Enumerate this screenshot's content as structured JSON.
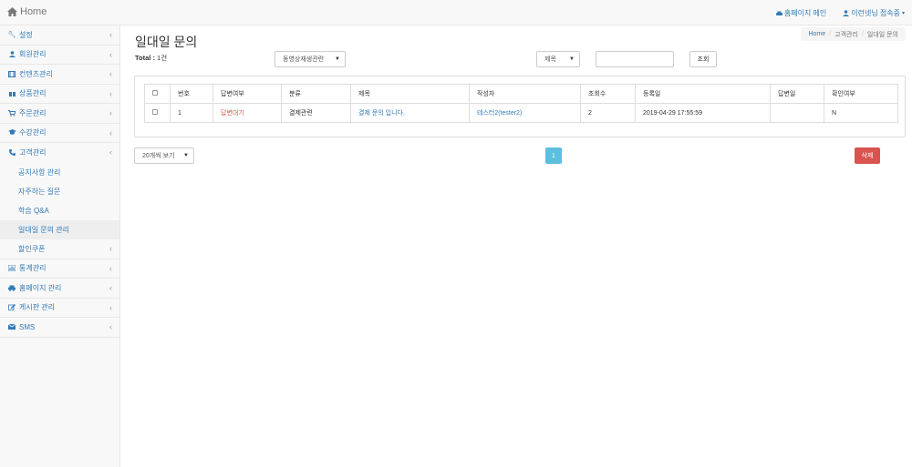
{
  "header": {
    "brand": "Home",
    "homepage_link": "홈페이지 메인",
    "user_link": "이런넷님 접속중"
  },
  "sidebar": {
    "items": [
      {
        "label": "설정",
        "icon": "wrench-icon"
      },
      {
        "label": "회원관리",
        "icon": "user-icon"
      },
      {
        "label": "컨텐츠관리",
        "icon": "film-icon"
      },
      {
        "label": "상품관리",
        "icon": "gift-icon"
      },
      {
        "label": "주문관리",
        "icon": "cart-icon"
      },
      {
        "label": "수강관리",
        "icon": "graduation-cap-icon"
      },
      {
        "label": "고객관리",
        "icon": "phone-icon"
      }
    ],
    "sub_items": [
      {
        "label": "공지사항 관리"
      },
      {
        "label": "자주하는 질문"
      },
      {
        "label": "학습 Q&A"
      },
      {
        "label": "일대일 문의 관리",
        "active": true
      },
      {
        "label": "할인쿠폰"
      }
    ],
    "bottom_items": [
      {
        "label": "통계관리",
        "icon": "bar-chart-icon"
      },
      {
        "label": "홈페이지 관리",
        "icon": "car-icon"
      },
      {
        "label": "게시판 관리",
        "icon": "edit-icon"
      },
      {
        "label": "SMS",
        "icon": "envelope-icon"
      }
    ]
  },
  "breadcrumb": {
    "home": "Home",
    "parent": "고객관리",
    "current": "일대일 문의"
  },
  "page": {
    "title": "일대일 문의",
    "total_label": "Total :",
    "total_count": "1건"
  },
  "filters": {
    "category_select": "동영상재생관련",
    "field_select": "제목",
    "search_value": "",
    "search_button": "조회"
  },
  "table": {
    "headers": [
      "",
      "번호",
      "답변여부",
      "분류",
      "제목",
      "작성자",
      "조회수",
      "등록일",
      "답변일",
      "확인여부"
    ],
    "rows": [
      {
        "no": "1",
        "status": "답변대기",
        "category": "결제관련",
        "title": "결제 문의 입니다.",
        "author": "테스터2(tester2)",
        "views": "2",
        "registered": "2019-04-29 17:55:59",
        "answered": "",
        "confirmed": "N"
      }
    ]
  },
  "footer": {
    "page_size_select": "20개씩 보기",
    "current_page": "1",
    "delete_button": "삭제"
  },
  "colors": {
    "link": "#337ab7",
    "pager": "#5bc0de",
    "delete": "#d9534f",
    "status_waiting": "#d9534f"
  }
}
